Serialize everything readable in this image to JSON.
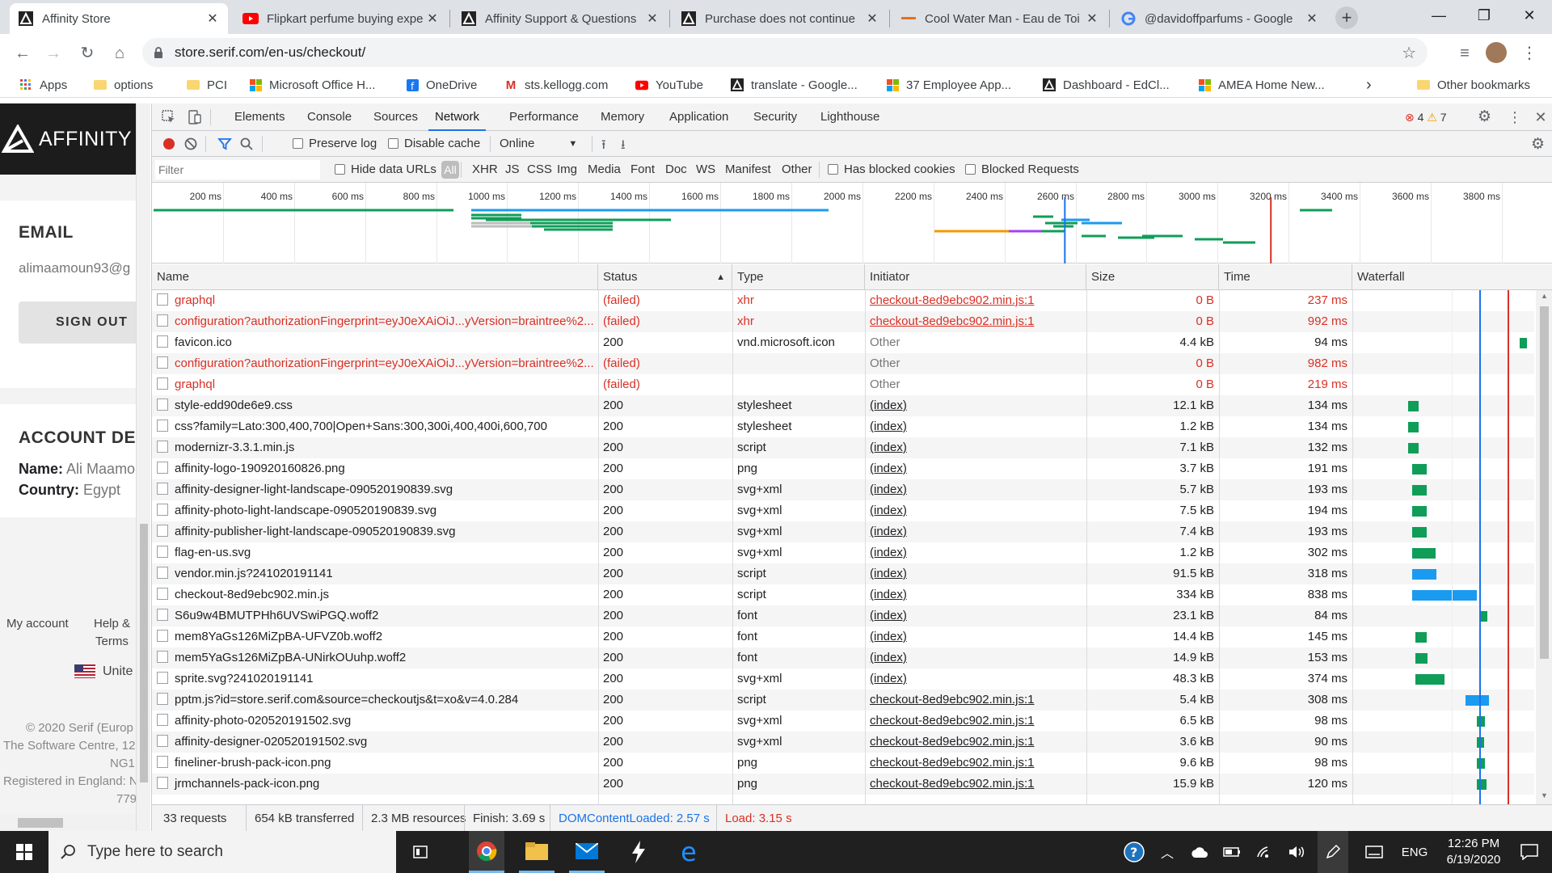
{
  "browser": {
    "tabs": [
      {
        "title": "Affinity Store",
        "active": true
      },
      {
        "title": "Flipkart perfume buying expe",
        "active": false
      },
      {
        "title": "Affinity Support & Questions",
        "active": false
      },
      {
        "title": "Purchase does not continue",
        "active": false
      },
      {
        "title": "Cool Water Man - Eau de Toi",
        "active": false
      },
      {
        "title": "@davidoffparfums - Google",
        "active": false
      }
    ],
    "url": "store.serif.com/en-us/checkout/",
    "bookmarks": [
      "Apps",
      "options",
      "PCI",
      "Microsoft Office H...",
      "OneDrive",
      "sts.kellogg.com",
      "YouTube",
      "translate - Google...",
      "37 Employee App...",
      "Dashboard - EdCl...",
      "AMEA Home New..."
    ],
    "other_bookmarks": "Other bookmarks"
  },
  "site": {
    "logo": "AFFINITY",
    "email_heading": "EMAIL",
    "email_value": "alimaamoun93@g",
    "sign_out": "SIGN OUT",
    "account_heading": "ACCOUNT DET",
    "name_label": "Name:",
    "name_value": "Ali Maamo",
    "country_label": "Country:",
    "country_value": "Egypt",
    "footer_my_account": "My account",
    "footer_help": "Help &",
    "footer_terms": "Terms",
    "footer_country": "Unite",
    "copyright1": "© 2020 Serif (Europ",
    "copyright2": "The Software Centre, 12",
    "copyright3": "NG1",
    "copyright4": "Registered in England: N",
    "copyright5": "779"
  },
  "devtools": {
    "tabs": [
      "Elements",
      "Console",
      "Sources",
      "Network",
      "Performance",
      "Memory",
      "Application",
      "Security",
      "Lighthouse"
    ],
    "active_tab": "Network",
    "errors": "4",
    "warnings": "7",
    "preserve_log": "Preserve log",
    "disable_cache": "Disable cache",
    "throttle": "Online",
    "filter_placeholder": "Filter",
    "hide_data_urls": "Hide data URLs",
    "types": [
      "All",
      "XHR",
      "JS",
      "CSS",
      "Img",
      "Media",
      "Font",
      "Doc",
      "WS",
      "Manifest",
      "Other"
    ],
    "has_blocked_cookies": "Has blocked cookies",
    "blocked_requests": "Blocked Requests",
    "timeline_ticks": [
      "200 ms",
      "400 ms",
      "600 ms",
      "800 ms",
      "1000 ms",
      "1200 ms",
      "1400 ms",
      "1600 ms",
      "1800 ms",
      "2000 ms",
      "2200 ms",
      "2400 ms",
      "2600 ms",
      "2800 ms",
      "3000 ms",
      "3200 ms",
      "3400 ms",
      "3600 ms",
      "3800 ms"
    ],
    "columns": [
      "Name",
      "Status",
      "Type",
      "Initiator",
      "Size",
      "Time",
      "Waterfall"
    ],
    "rows": [
      {
        "name": "graphql",
        "status": "(failed)",
        "type": "xhr",
        "initiator": "checkout-8ed9ebc902.min.js:1",
        "size": "0 B",
        "time": "237 ms",
        "failed": true,
        "link": true,
        "wf_start_ms": 0,
        "wf_dur_ms": 0
      },
      {
        "name": "configuration?authorizationFingerprint=eyJ0eXAiOiJ...yVersion=braintree%2...",
        "status": "(failed)",
        "type": "xhr",
        "initiator": "checkout-8ed9ebc902.min.js:1",
        "size": "0 B",
        "time": "992 ms",
        "failed": true,
        "link": true,
        "wf_start_ms": 0,
        "wf_dur_ms": 0
      },
      {
        "name": "favicon.ico",
        "status": "200",
        "type": "vnd.microsoft.icon",
        "initiator": "Other",
        "size": "4.4 kB",
        "time": "94 ms",
        "failed": false,
        "link": false,
        "wf_start_ms": 3400,
        "wf_dur_ms": 94
      },
      {
        "name": "configuration?authorizationFingerprint=eyJ0eXAiOiJ...yVersion=braintree%2...",
        "status": "(failed)",
        "type": "",
        "initiator": "Other",
        "size": "0 B",
        "time": "982 ms",
        "failed": true,
        "link": false,
        "wf_start_ms": 0,
        "wf_dur_ms": 0
      },
      {
        "name": "graphql",
        "status": "(failed)",
        "type": "",
        "initiator": "Other",
        "size": "0 B",
        "time": "219 ms",
        "failed": true,
        "link": false,
        "wf_start_ms": 0,
        "wf_dur_ms": 0
      },
      {
        "name": "style-edd90de6e9.css",
        "status": "200",
        "type": "stylesheet",
        "initiator": "(index)",
        "size": "12.1 kB",
        "time": "134 ms",
        "failed": false,
        "link": true,
        "wf_start_ms": 1100,
        "wf_dur_ms": 134
      },
      {
        "name": "css?family=Lato:300,400,700|Open+Sans:300,300i,400,400i,600,700",
        "status": "200",
        "type": "stylesheet",
        "initiator": "(index)",
        "size": "1.2 kB",
        "time": "134 ms",
        "failed": false,
        "link": true,
        "wf_start_ms": 1100,
        "wf_dur_ms": 134
      },
      {
        "name": "modernizr-3.3.1.min.js",
        "status": "200",
        "type": "script",
        "initiator": "(index)",
        "size": "7.1 kB",
        "time": "132 ms",
        "failed": false,
        "link": true,
        "wf_start_ms": 1100,
        "wf_dur_ms": 132
      },
      {
        "name": "affinity-logo-190920160826.png",
        "status": "200",
        "type": "png",
        "initiator": "(index)",
        "size": "3.7 kB",
        "time": "191 ms",
        "failed": false,
        "link": true,
        "wf_start_ms": 1180,
        "wf_dur_ms": 191
      },
      {
        "name": "affinity-designer-light-landscape-090520190839.svg",
        "status": "200",
        "type": "svg+xml",
        "initiator": "(index)",
        "size": "5.7 kB",
        "time": "193 ms",
        "failed": false,
        "link": true,
        "wf_start_ms": 1180,
        "wf_dur_ms": 193
      },
      {
        "name": "affinity-photo-light-landscape-090520190839.svg",
        "status": "200",
        "type": "svg+xml",
        "initiator": "(index)",
        "size": "7.5 kB",
        "time": "194 ms",
        "failed": false,
        "link": true,
        "wf_start_ms": 1180,
        "wf_dur_ms": 194
      },
      {
        "name": "affinity-publisher-light-landscape-090520190839.svg",
        "status": "200",
        "type": "svg+xml",
        "initiator": "(index)",
        "size": "7.4 kB",
        "time": "193 ms",
        "failed": false,
        "link": true,
        "wf_start_ms": 1180,
        "wf_dur_ms": 193
      },
      {
        "name": "flag-en-us.svg",
        "status": "200",
        "type": "svg+xml",
        "initiator": "(index)",
        "size": "1.2 kB",
        "time": "302 ms",
        "failed": false,
        "link": true,
        "wf_start_ms": 1180,
        "wf_dur_ms": 302
      },
      {
        "name": "vendor.min.js?241020191141",
        "status": "200",
        "type": "script",
        "initiator": "(index)",
        "size": "91.5 kB",
        "time": "318 ms",
        "failed": false,
        "link": true,
        "wf_start_ms": 1180,
        "wf_dur_ms": 318
      },
      {
        "name": "checkout-8ed9ebc902.min.js",
        "status": "200",
        "type": "script",
        "initiator": "(index)",
        "size": "334 kB",
        "time": "838 ms",
        "failed": false,
        "link": true,
        "wf_start_ms": 1180,
        "wf_dur_ms": 838
      },
      {
        "name": "S6u9w4BMUTPHh6UVSwiPGQ.woff2",
        "status": "200",
        "type": "font",
        "initiator": "(index)",
        "size": "23.1 kB",
        "time": "84 ms",
        "failed": false,
        "link": true,
        "wf_start_ms": 2600,
        "wf_dur_ms": 84
      },
      {
        "name": "mem8YaGs126MiZpBA-UFVZ0b.woff2",
        "status": "200",
        "type": "font",
        "initiator": "(index)",
        "size": "14.4 kB",
        "time": "145 ms",
        "failed": false,
        "link": true,
        "wf_start_ms": 1250,
        "wf_dur_ms": 145
      },
      {
        "name": "mem5YaGs126MiZpBA-UNirkOUuhp.woff2",
        "status": "200",
        "type": "font",
        "initiator": "(index)",
        "size": "14.9 kB",
        "time": "153 ms",
        "failed": false,
        "link": true,
        "wf_start_ms": 1250,
        "wf_dur_ms": 153
      },
      {
        "name": "sprite.svg?241020191141",
        "status": "200",
        "type": "svg+xml",
        "initiator": "(index)",
        "size": "48.3 kB",
        "time": "374 ms",
        "failed": false,
        "link": true,
        "wf_start_ms": 1250,
        "wf_dur_ms": 374
      },
      {
        "name": "pptm.js?id=store.serif.com&source=checkoutjs&t=xo&v=4.0.284",
        "status": "200",
        "type": "script",
        "initiator": "checkout-8ed9ebc902.min.js:1",
        "size": "5.4 kB",
        "time": "308 ms",
        "failed": false,
        "link": true,
        "wf_start_ms": 2280,
        "wf_dur_ms": 308
      },
      {
        "name": "affinity-photo-020520191502.svg",
        "status": "200",
        "type": "svg+xml",
        "initiator": "checkout-8ed9ebc902.min.js:1",
        "size": "6.5 kB",
        "time": "98 ms",
        "failed": false,
        "link": true,
        "wf_start_ms": 2520,
        "wf_dur_ms": 98
      },
      {
        "name": "affinity-designer-020520191502.svg",
        "status": "200",
        "type": "svg+xml",
        "initiator": "checkout-8ed9ebc902.min.js:1",
        "size": "3.6 kB",
        "time": "90 ms",
        "failed": false,
        "link": true,
        "wf_start_ms": 2520,
        "wf_dur_ms": 90
      },
      {
        "name": "fineliner-brush-pack-icon.png",
        "status": "200",
        "type": "png",
        "initiator": "checkout-8ed9ebc902.min.js:1",
        "size": "9.6 kB",
        "time": "98 ms",
        "failed": false,
        "link": true,
        "wf_start_ms": 2520,
        "wf_dur_ms": 98
      },
      {
        "name": "jrmchannels-pack-icon.png",
        "status": "200",
        "type": "png",
        "initiator": "checkout-8ed9ebc902.min.js:1",
        "size": "15.9 kB",
        "time": "120 ms",
        "failed": false,
        "link": true,
        "wf_start_ms": 2520,
        "wf_dur_ms": 120
      }
    ],
    "summary": {
      "requests": "33 requests",
      "transferred": "654 kB transferred",
      "resources": "2.3 MB resources",
      "finish": "Finish: 3.69 s",
      "domcontentloaded": "DOMContentLoaded: 2.57 s",
      "load": "Load: 3.15 s"
    },
    "colors": {
      "dcl": "#1a73e8",
      "load": "#d93025",
      "bar_green": "#0f9d58",
      "bar_blue": "#1a9bf0",
      "failed": "#d93025"
    }
  },
  "taskbar": {
    "search_placeholder": "Type here to search",
    "language": "ENG",
    "time": "12:26 PM",
    "date": "6/19/2020"
  }
}
